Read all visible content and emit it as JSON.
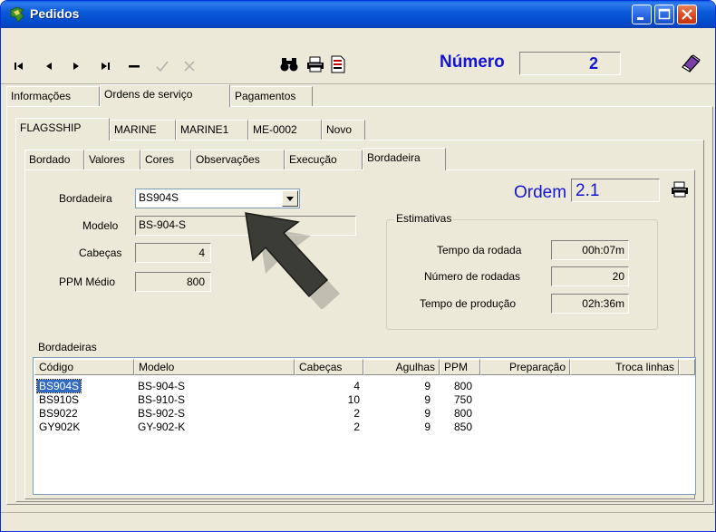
{
  "window": {
    "title": "Pedidos"
  },
  "toolbar": {
    "buttons": [
      "first-icon",
      "previous-icon",
      "next-icon",
      "last-icon",
      "delete-icon",
      "confirm-icon",
      "cancel-icon",
      "binoculars-icon",
      "printer-icon",
      "report-icon",
      "exit-icon"
    ],
    "numero_label": "Número",
    "numero_value": "2"
  },
  "tabs_main": [
    "Informações",
    "Ordens de serviço",
    "Pagamentos"
  ],
  "tabs_orders": [
    "FLAGSSHIP",
    "MARINE",
    "MARINE1",
    "ME-0002",
    "Novo"
  ],
  "tabs_sub": [
    "Bordado",
    "Valores",
    "Cores",
    "Observações",
    "Execução",
    "Bordadeira"
  ],
  "form": {
    "bordadeira_label": "Bordadeira",
    "bordadeira_value": "BS904S",
    "modelo_label": "Modelo",
    "modelo_value": "BS-904-S",
    "cabecas_label": "Cabeças",
    "cabecas_value": "4",
    "ppm_label": "PPM Médio",
    "ppm_value": "800",
    "ordem_label": "Ordem",
    "ordem_value": "2.1"
  },
  "estimativas": {
    "title": "Estimativas",
    "tempo_rodada_label": "Tempo da rodada",
    "tempo_rodada_value": "00h:07m",
    "numero_rodadas_label": "Número de rodadas",
    "numero_rodadas_value": "20",
    "tempo_producao_label": "Tempo de produção",
    "tempo_producao_value": "02h:36m"
  },
  "bordadeiras": {
    "title": "Bordadeiras",
    "columns": [
      "Código",
      "Modelo",
      "Cabeças",
      "Agulhas",
      "PPM",
      "Preparação",
      "Troca linhas"
    ],
    "rows": [
      {
        "codigo": "BS904S",
        "modelo": "BS-904-S",
        "cabecas": "4",
        "agulhas": "9",
        "ppm": "800"
      },
      {
        "codigo": "BS910S",
        "modelo": "BS-910-S",
        "cabecas": "10",
        "agulhas": "9",
        "ppm": "750"
      },
      {
        "codigo": "BS9022",
        "modelo": "BS-902-S",
        "cabecas": "2",
        "agulhas": "9",
        "ppm": "800"
      },
      {
        "codigo": "GY902K",
        "modelo": "GY-902-K",
        "cabecas": "2",
        "agulhas": "9",
        "ppm": "850"
      }
    ]
  },
  "colors": {
    "title_blue": "#0b5ad9",
    "accent_blue": "#1414d7",
    "selection": "#316ac5"
  }
}
